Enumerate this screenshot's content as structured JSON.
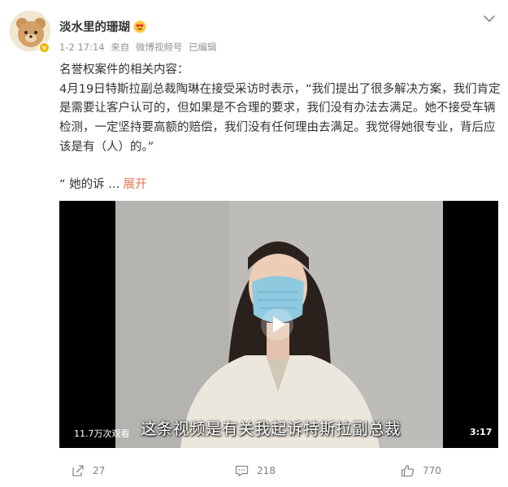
{
  "post": {
    "author": "淡水里的珊瑚",
    "time": "1-2 17:14",
    "source_prefix": "来自",
    "source": "微博视频号",
    "edited": "已编辑",
    "text_lines": [
      "名誉权案件的相关内容：",
      "4月19日特斯拉副总裁陶琳在接受采访时表示，“我们提出了很多解决方案，我们肯定",
      "是需要让客户认可的，但如果是不合理的要求，我们没有办法去满足。她不接受车辆",
      "检测，一定坚持要高额的赔偿，我们没有任何理由去满足。我觉得她很专业，背后应",
      "该是有（人）的。”"
    ],
    "truncated_text": "“ 她的诉 ...",
    "expand_label": "展开"
  },
  "video": {
    "views": "11.7万次观看",
    "duration": "3:17",
    "subtitle": "这条视频是有关我起诉特斯拉副总裁"
  },
  "actions": {
    "share_count": "27",
    "comment_count": "218",
    "like_count": "770"
  },
  "colors": {
    "accent": "#eb7350",
    "meta_gray": "#939393",
    "badge": "#f6b500"
  }
}
